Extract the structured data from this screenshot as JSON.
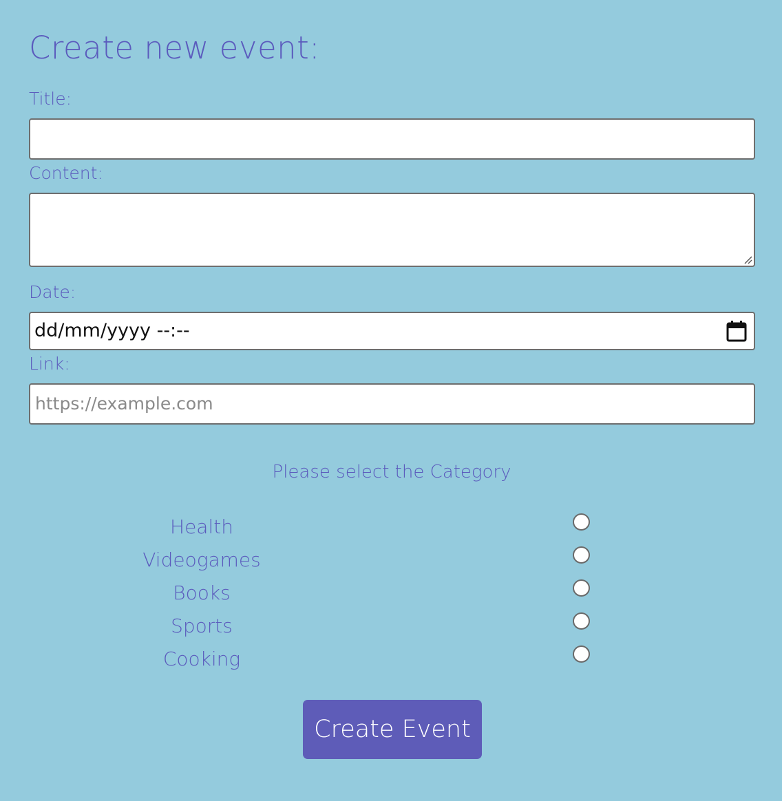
{
  "page": {
    "title": "Create new event:"
  },
  "form": {
    "title_label": "Title:",
    "title_value": "",
    "content_label": "Content:",
    "content_value": "",
    "date_label": "Date:",
    "date_value": "dd/mm/yyyy --:--",
    "link_label": "Link:",
    "link_placeholder": "https://example.com",
    "link_value": ""
  },
  "category": {
    "heading": "Please select the Category",
    "options": [
      {
        "label": "Health",
        "selected": false
      },
      {
        "label": "Videogames",
        "selected": false
      },
      {
        "label": "Books",
        "selected": false
      },
      {
        "label": "Sports",
        "selected": false
      },
      {
        "label": "Cooking",
        "selected": false
      }
    ]
  },
  "submit": {
    "label": "Create Event"
  },
  "icons": {
    "date_picker": "calendar-icon",
    "textarea_resize": "resize-handle-icon"
  },
  "colors": {
    "background": "#94cbdd",
    "text": "#5b5bbd",
    "button": "#5e5cb8",
    "button_text": "#ffffff"
  }
}
